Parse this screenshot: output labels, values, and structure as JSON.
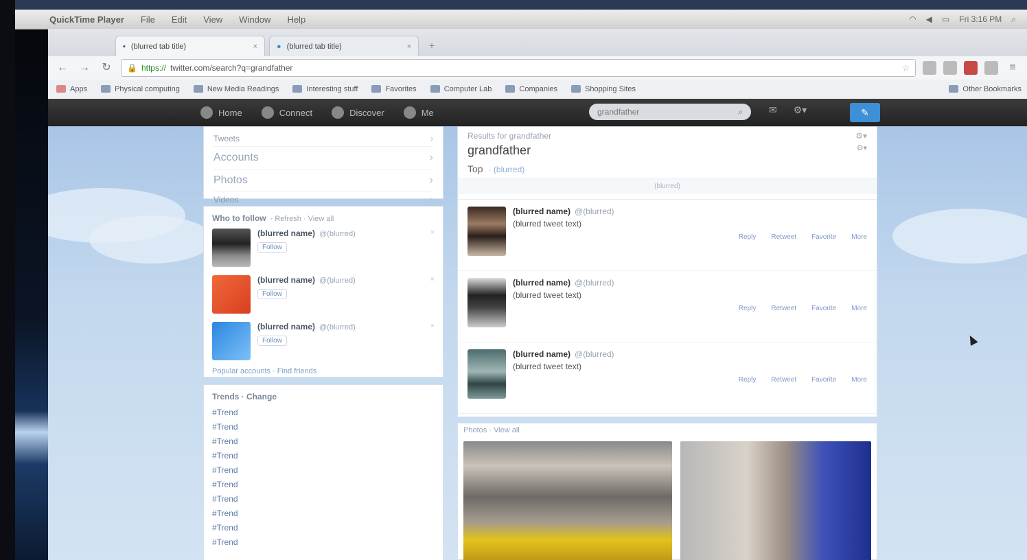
{
  "menubar": {
    "app": "QuickTime Player",
    "items": [
      "File",
      "Edit",
      "View",
      "Window",
      "Help"
    ],
    "clock": "Fri 3:16 PM"
  },
  "browser": {
    "tabs": [
      {
        "label": "(blurred tab title)"
      },
      {
        "label": "(blurred tab title)"
      }
    ],
    "url_scheme": "https://",
    "url": "twitter.com/search?q=grandfather",
    "bookmarks": [
      "Apps",
      "Physical computing",
      "New Media Readings",
      "Interesting stuff",
      "Favorites",
      "Computer Lab",
      "Companies",
      "Shopping Sites",
      "Other Bookmarks"
    ]
  },
  "twitter": {
    "nav": [
      "Home",
      "Connect",
      "Discover",
      "Me"
    ],
    "search_placeholder": "grandfather",
    "compose_label": "✎"
  },
  "left": {
    "nav_items": [
      "Tweets",
      "Accounts",
      "Photos",
      "Videos"
    ],
    "wtf_title": "Who to follow",
    "wtf_sub": "· Refresh · View all",
    "suggestions": [
      {
        "name": "(blurred name)",
        "handle": "@(blurred)",
        "follow": "Follow"
      },
      {
        "name": "(blurred name)",
        "handle": "@(blurred)",
        "follow": "Follow"
      },
      {
        "name": "(blurred name)",
        "handle": "@(blurred)",
        "follow": "Follow"
      }
    ],
    "wtf_footer": "Popular accounts · Find friends",
    "trends_title": "Trends · Change",
    "trends": [
      {
        "tag": "#Trend",
        "desc": ""
      },
      {
        "tag": "#Trend",
        "desc": ""
      },
      {
        "tag": "#Trend",
        "desc": ""
      },
      {
        "tag": "#Trend",
        "desc": ""
      },
      {
        "tag": "#Trend",
        "desc": ""
      },
      {
        "tag": "#Trend",
        "desc": ""
      },
      {
        "tag": "#Trend",
        "desc": ""
      },
      {
        "tag": "#Trend",
        "desc": ""
      },
      {
        "tag": "#Trend",
        "desc": ""
      },
      {
        "tag": "#Trend",
        "desc": ""
      }
    ]
  },
  "results": {
    "results_for": "Results for grandfather",
    "query": "grandfather",
    "top_label": "Top",
    "top_people": "· (blurred)",
    "new_results": "(blurred)",
    "tweets": [
      {
        "name": "(blurred name)",
        "handle": "@(blurred)",
        "time": "",
        "text": "(blurred tweet text)",
        "actions": [
          "Reply",
          "Retweet",
          "Favorite",
          "More"
        ]
      },
      {
        "name": "(blurred name)",
        "handle": "@(blurred)",
        "time": "",
        "text": "(blurred tweet text)",
        "actions": [
          "Reply",
          "Retweet",
          "Favorite",
          "More"
        ]
      },
      {
        "name": "(blurred name)",
        "handle": "@(blurred)",
        "time": "",
        "text": "(blurred tweet text)",
        "actions": [
          "Reply",
          "Retweet",
          "Favorite",
          "More"
        ]
      }
    ],
    "photos_title": "Photos · View all"
  },
  "colors": {
    "accent": "#3d8fd6",
    "header": "#2b2b2b",
    "background": "#c3d8ee"
  }
}
